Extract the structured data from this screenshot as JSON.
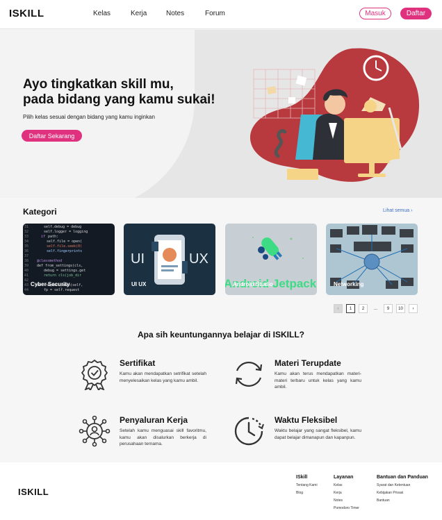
{
  "nav": {
    "logo": "ISKILL",
    "links": [
      "Kelas",
      "Kerja",
      "Notes",
      "Forum"
    ],
    "masuk": "Masuk",
    "daftar": "Daftar"
  },
  "hero": {
    "title_line1": "Ayo tingkatkan skill mu,",
    "title_line2": "pada bidang yang kamu sukai!",
    "subtitle": "Pilih kelas sesuai dengan bidang yang kamu inginkan",
    "cta": "Daftar Sekarang"
  },
  "kategori": {
    "title": "Kategori",
    "see_all": "Lihat semua",
    "cards": [
      {
        "label": "Cyber Security"
      },
      {
        "label": "UI UX",
        "img_left": "UI",
        "img_right": "UX"
      },
      {
        "label": "Android Studio",
        "img_text": "Android Jetpack"
      },
      {
        "label": "Networking"
      }
    ]
  },
  "pagination": {
    "prev": "‹",
    "pages": [
      "1",
      "2",
      "...",
      "9",
      "10"
    ],
    "next": "›",
    "active": "1"
  },
  "benefits": {
    "title": "Apa sih keuntungannya belajar di ISKILL?",
    "items": [
      {
        "icon": "certificate-icon",
        "title": "Sertifikat",
        "text": "Kamu akan mendapatkan setrifikat setelah menyelesaikan kelas yang kamu ambil."
      },
      {
        "icon": "refresh-icon",
        "title": "Materi Terupdate",
        "text": "Kamu akan terus mendapatkan materi-materi terbaru untuk kelas yang kamu ambil."
      },
      {
        "icon": "network-person-icon",
        "title": "Penyaluran Kerja",
        "text": "Setelah kamu menguasai skill favoritmu, kamu akan disalurkan berkerja di perusahaan ternama."
      },
      {
        "icon": "clock-icon",
        "title": "Waktu Fleksibel",
        "text": "Waktu belajar yang sangat fleksibel, kamu dapat belajar dimanapun dan kapanpun."
      }
    ]
  },
  "footer": {
    "logo": "ISKILL",
    "columns": [
      {
        "title": "ISkill",
        "items": [
          "Tentang Kami",
          "Blog"
        ]
      },
      {
        "title": "Layanan",
        "items": [
          "Kelas",
          "Kerja",
          "Notes",
          "Pomodoro Timer"
        ]
      },
      {
        "title": "Bantuan dan Panduan",
        "items": [
          "Syarat dan Ketentuan",
          "Kebijakan Privasi",
          "Bantuan"
        ]
      }
    ]
  },
  "colors": {
    "accent": "#e0317e",
    "hero_bg": "#e6e6e6",
    "illustration_red": "#b83a3e"
  }
}
